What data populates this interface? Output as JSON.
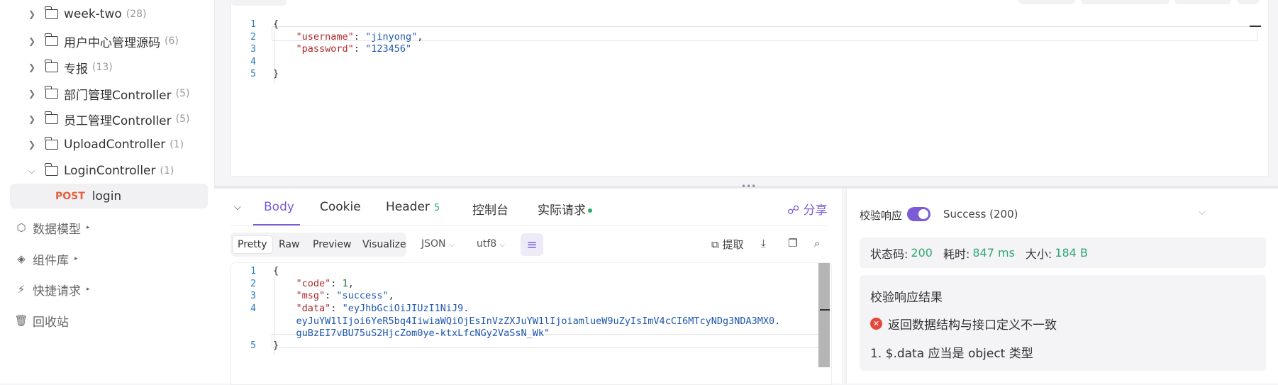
{
  "sidebar": {
    "folders": [
      {
        "label": "week-two",
        "count": "(28)"
      },
      {
        "label": "用户中心管理源码",
        "count": "(6)"
      },
      {
        "label": "专报",
        "count": "(13)"
      },
      {
        "label": "部门管理Controller",
        "count": "(5)"
      },
      {
        "label": "员工管理Controller",
        "count": "(5)"
      },
      {
        "label": "UploadController",
        "count": "(1)"
      },
      {
        "label": "LoginController",
        "count": "(1)"
      }
    ],
    "selected_endpoint": {
      "method": "POST",
      "name": "login"
    },
    "nav": [
      {
        "label": "数据模型",
        "icon": "cube-icon"
      },
      {
        "label": "组件库",
        "icon": "layers-icon"
      },
      {
        "label": "快捷请求",
        "icon": "bolt-icon"
      },
      {
        "label": "回收站",
        "icon": "trash-icon"
      }
    ]
  },
  "request_body": {
    "line_numbers": [
      "1",
      "2",
      "3",
      "4",
      "5"
    ],
    "lines": [
      {
        "parts": [
          {
            "t": "{",
            "c": "p"
          }
        ]
      },
      {
        "parts": [
          {
            "t": "    ",
            "c": "p"
          },
          {
            "t": "\"username\"",
            "c": "k"
          },
          {
            "t": ": ",
            "c": "p"
          },
          {
            "t": "\"jinyong\"",
            "c": "s"
          },
          {
            "t": ",",
            "c": "p"
          }
        ]
      },
      {
        "parts": [
          {
            "t": "    ",
            "c": "p"
          },
          {
            "t": "\"password\"",
            "c": "k"
          },
          {
            "t": ": ",
            "c": "p"
          },
          {
            "t": "\"123456\"",
            "c": "s"
          }
        ]
      },
      {
        "parts": [
          {
            "t": "",
            "c": "p"
          }
        ]
      },
      {
        "parts": [
          {
            "t": "}",
            "c": "p"
          }
        ]
      }
    ]
  },
  "response": {
    "tabs": {
      "body": "Body",
      "cookie": "Cookie",
      "header": "Header",
      "header_count": "5",
      "console": "控制台",
      "actual_request": "实际请求"
    },
    "share_label": "分享",
    "format_buttons": [
      "Pretty",
      "Raw",
      "Preview",
      "Visualize"
    ],
    "format_type": "JSON",
    "encoding": "utf8",
    "extract_label": "提取",
    "line_numbers": [
      "1",
      "2",
      "3",
      "4",
      "",
      "",
      "5"
    ],
    "lines": [
      {
        "parts": [
          {
            "t": "{",
            "c": "p"
          }
        ]
      },
      {
        "parts": [
          {
            "t": "    ",
            "c": "p"
          },
          {
            "t": "\"code\"",
            "c": "k"
          },
          {
            "t": ": ",
            "c": "p"
          },
          {
            "t": "1",
            "c": "n"
          },
          {
            "t": ",",
            "c": "p"
          }
        ]
      },
      {
        "parts": [
          {
            "t": "    ",
            "c": "p"
          },
          {
            "t": "\"msg\"",
            "c": "k"
          },
          {
            "t": ": ",
            "c": "p"
          },
          {
            "t": "\"success\"",
            "c": "s"
          },
          {
            "t": ",",
            "c": "p"
          }
        ]
      },
      {
        "parts": [
          {
            "t": "    ",
            "c": "p"
          },
          {
            "t": "\"data\"",
            "c": "k"
          },
          {
            "t": ": ",
            "c": "p"
          },
          {
            "t": "\"eyJhbGciOiJIUzI1NiJ9.",
            "c": "s"
          }
        ]
      },
      {
        "parts": [
          {
            "t": "    ",
            "c": "p"
          },
          {
            "t": "eyJuYW1lIjoi6YeR5bq4IiwiaWQiOjEsInVzZXJuYW1lIjoiamlueW9uZyIsImV4cCI6MTcyNDg3NDA3MX0.",
            "c": "s"
          }
        ]
      },
      {
        "parts": [
          {
            "t": "    ",
            "c": "p"
          },
          {
            "t": "guBzEI7vBU75uS2HjcZom0ye-ktxLfcNGy2VaSsN_Wk\"",
            "c": "s"
          }
        ]
      },
      {
        "parts": [
          {
            "t": "}",
            "c": "p"
          }
        ]
      }
    ]
  },
  "validation": {
    "toggle_label": "校验响应",
    "toggle_on": true,
    "selected_response": "Success (200)",
    "status_label": "状态码:",
    "status_value": "200",
    "time_label": "耗时:",
    "time_value": "847 ms",
    "size_label": "大小:",
    "size_value": "184 B",
    "result_title": "校验响应结果",
    "error_message": "返回数据结构与接口定义不一致",
    "error_detail": "1. $.data 应当是 object 类型"
  },
  "colors": {
    "accent": "#7b5cd6",
    "method_post": "#e8603c",
    "success": "#2da86f",
    "error": "#e5473c"
  }
}
